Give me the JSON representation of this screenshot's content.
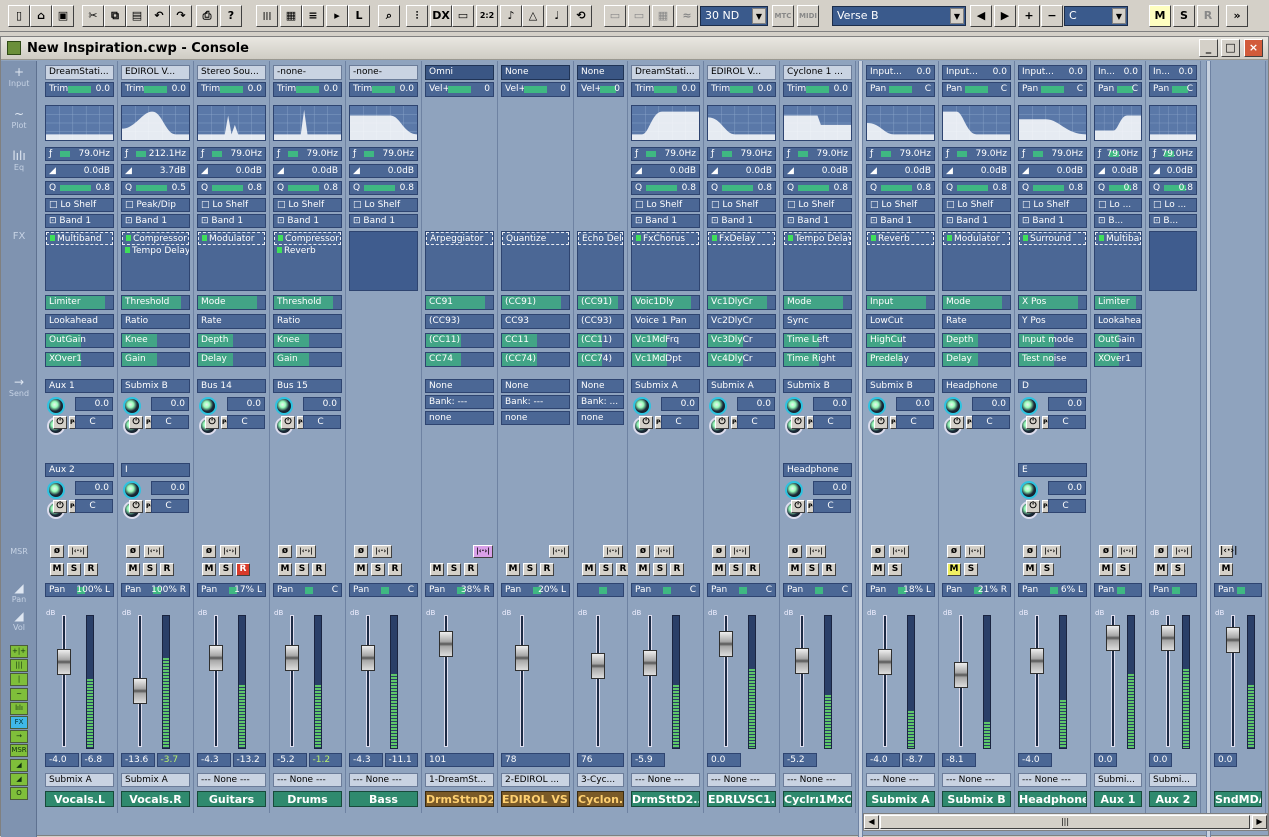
{
  "toolbar": {
    "buttons": [
      "new-icon",
      "open-icon",
      "save-icon",
      "cut-icon",
      "copy-icon",
      "paste-icon",
      "undo-icon",
      "redo-icon",
      "print-icon",
      "help-icon",
      "piano-icon",
      "grid-icon",
      "list-icon",
      "play-list-icon",
      "L",
      "zoom-icon",
      "console-icon",
      "dx-icon",
      "window-icon",
      "2:2",
      "staff-icon",
      "pattern-icon",
      "tempo-icon",
      "loop-icon",
      "monitor-icon",
      "midi-in-icon",
      "midi-out-icon",
      "wave-icon"
    ],
    "fx_preset": "30 ND",
    "mtc_label": "MTC",
    "midi_label": "MIDI",
    "section": "Verse B",
    "key": "C",
    "m_label": "M",
    "s_label": "S",
    "r_label": "R",
    "more_label": "»"
  },
  "window": {
    "title": "New Inspiration.cwp - Console",
    "min": "_",
    "max": "□",
    "close": "×"
  },
  "sidebar": {
    "labels": [
      "Input",
      "Plot",
      "Eq",
      "FX",
      "Send",
      "MSR",
      "Pan",
      "Vol"
    ],
    "buttons": [
      "+|+",
      "|||",
      "|",
      "~",
      "lılı",
      "FX",
      "→",
      "MSR",
      "◢",
      "◢",
      "O"
    ]
  },
  "strips": [
    {
      "input": "DreamStati...",
      "trim_label": "Trim",
      "trim": "0.0",
      "freq": "79.0Hz",
      "gain": "0.0dB",
      "q": "0.8",
      "shelf": "Lo Shelf",
      "band": "Band 1",
      "fx": [
        "Multiband"
      ],
      "fx_sel": 0,
      "params": [
        "Limiter",
        "Lookahead",
        "OutGain",
        "XOver1"
      ],
      "send1": "Aux 1",
      "send1_val": "0.0",
      "send1_pan": "C",
      "send2": "Aux 2",
      "send2_val": "0.0",
      "send2_pan": "C",
      "pan": "100% L",
      "left_ro": "-4.0",
      "right_ro": "-6.8",
      "out": "Submix A",
      "name": "Vocals.L",
      "kind": "audio"
    },
    {
      "input": "EDIROL V...",
      "trim_label": "Trim",
      "trim": "0.0",
      "freq": "212.1Hz",
      "gain": "3.7dB",
      "q": "0.5",
      "shelf": "Peak/Dip",
      "band": "Band 1",
      "fx": [
        "Compressor",
        "Tempo Delay"
      ],
      "fx_sel": 0,
      "params": [
        "Threshold",
        "Ratio",
        "Knee",
        "Gain"
      ],
      "send1": "Submix B",
      "send1_val": "0.0",
      "send1_pan": "C",
      "send2": "I",
      "send2_val": "0.0",
      "send2_pan": "C",
      "pan": "100% R",
      "left_ro": "-13.6",
      "right_ro": "-3.7",
      "out": "Submix A",
      "name": "Vocals.R",
      "kind": "audio"
    },
    {
      "input": "Stereo Sou...",
      "trim_label": "Trim",
      "trim": "0.0",
      "freq": "79.0Hz",
      "gain": "0.0dB",
      "q": "0.8",
      "shelf": "Lo Shelf",
      "band": "Band 1",
      "fx": [
        "Modulator"
      ],
      "fx_sel": 0,
      "params": [
        "Mode",
        "Rate",
        "Depth",
        "Delay"
      ],
      "send1": "Bus 14",
      "send1_val": "0.0",
      "send1_pan": "C",
      "pan": "17% L",
      "left_ro": "-4.3",
      "right_ro": "-13.2",
      "out": "--- None ---",
      "name": "Guitars",
      "kind": "audio",
      "rec": true
    },
    {
      "input": "-none-",
      "trim_label": "Trim",
      "trim": "0.0",
      "freq": "79.0Hz",
      "gain": "0.0dB",
      "q": "0.8",
      "shelf": "Lo Shelf",
      "band": "Band 1",
      "fx": [
        "Compressor",
        "Reverb"
      ],
      "fx_sel": 0,
      "params": [
        "Threshold",
        "Ratio",
        "Knee",
        "Gain"
      ],
      "send1": "Bus 15",
      "send1_val": "0.0",
      "send1_pan": "C",
      "pan": "C",
      "left_ro": "-5.2",
      "right_ro": "-1.2",
      "out": "--- None ---",
      "name": "Drums",
      "kind": "audio"
    },
    {
      "input": "-none-",
      "trim_label": "Trim",
      "trim": "0.0",
      "freq": "79.0Hz",
      "gain": "0.0dB",
      "q": "0.8",
      "shelf": "Lo Shelf",
      "band": "Band 1",
      "fx": [],
      "params": [],
      "pan": "C",
      "left_ro": "-4.3",
      "right_ro": "-11.1",
      "out": "--- None ---",
      "name": "Bass",
      "kind": "audio"
    },
    {
      "input": "Omni",
      "trim_label": "Vel+",
      "trim": "0",
      "fx": [
        "Arpeggiator"
      ],
      "fx_sel": 0,
      "params": [
        "CC91",
        "(CC93)",
        "(CC11)",
        "CC74"
      ],
      "sendsel": [
        "None",
        "Bank: ---",
        "none"
      ],
      "pan": "38% R",
      "left_ro": "101",
      "out": "1-DreamSt...",
      "name": "DrmSttnD21",
      "kind": "midi"
    },
    {
      "input": "None",
      "trim_label": "Vel+",
      "trim": "0",
      "fx": [
        "Quantize"
      ],
      "fx_sel": 0,
      "params": [
        "(CC91)",
        "CC93",
        "CC11",
        "(CC74)"
      ],
      "sendsel": [
        "None",
        "Bank: ---",
        "none"
      ],
      "pan": "20% L",
      "left_ro": "78",
      "out": "2-EDIROL ...",
      "name": "EDIROL VS...",
      "kind": "midi"
    },
    {
      "input": "None",
      "trim_label": "Vel+",
      "trim": "0",
      "fx": [
        "Echo Dela"
      ],
      "fx_sel": 0,
      "params": [
        "(CC91)",
        "(CC93)",
        "(CC11)",
        "(CC74)"
      ],
      "sendsel": [
        "None",
        "Bank: ...",
        "none"
      ],
      "pan": "",
      "left_ro": "76",
      "out": "3-Cyc...",
      "name": "Cyclon...",
      "kind": "midi"
    },
    {
      "input": "DreamStati...",
      "trim_label": "Trim",
      "trim": "0.0",
      "freq": "79.0Hz",
      "gain": "0.0dB",
      "q": "0.8",
      "shelf": "Lo Shelf",
      "band": "Band 1",
      "fx": [
        "FxChorus"
      ],
      "fx_sel": 0,
      "params": [
        "Voic1Dly",
        "Voice 1 Pan",
        "Vc1MdFrq",
        "Vc1MdDpt"
      ],
      "send1": "Submix A",
      "send1_val": "0.0",
      "send1_pan": "C",
      "pan": "C",
      "left_ro": "-5.9",
      "out": "--- None ---",
      "name": "DrmSttD2...",
      "kind": "synth"
    },
    {
      "input": "EDIROL V...",
      "trim_label": "Trim",
      "trim": "0.0",
      "freq": "79.0Hz",
      "gain": "0.0dB",
      "q": "0.8",
      "shelf": "Lo Shelf",
      "band": "Band 1",
      "fx": [
        "FxDelay"
      ],
      "fx_sel": 0,
      "params": [
        "Vc1DlyCr",
        "Vc2DlyCr",
        "Vc3DlyCr",
        "Vc4DlyCr"
      ],
      "send1": "Submix A",
      "send1_val": "0.0",
      "send1_pan": "C",
      "pan": "C",
      "left_ro": "0.0",
      "out": "--- None ---",
      "name": "EDRLVSC1...",
      "kind": "synth"
    },
    {
      "input": "Cyclone 1 ...",
      "trim_label": "Trim",
      "trim": "0.0",
      "freq": "79.0Hz",
      "gain": "0.0dB",
      "q": "0.8",
      "shelf": "Lo Shelf",
      "band": "Band 1",
      "fx": [
        "Tempo Delay"
      ],
      "fx_sel": 0,
      "params": [
        "Mode",
        "Sync",
        "Time Left",
        "Time Right"
      ],
      "send1": "Submix B",
      "send1_val": "0.0",
      "send1_pan": "C",
      "send2": "Headphone",
      "send2_val": "0.0",
      "send2_pan": "C",
      "pan": "C",
      "left_ro": "-5.2",
      "out": "--- None ---",
      "name": "Cyclrı1MxOt",
      "kind": "synth"
    },
    {
      "input": "Input...",
      "trim_label": "Pan",
      "trim": "C",
      "input_val": "0.0",
      "freq": "79.0Hz",
      "gain": "0.0dB",
      "q": "0.8",
      "shelf": "Lo Shelf",
      "band": "Band 1",
      "fx": [
        "Reverb"
      ],
      "fx_sel": 0,
      "params": [
        "Input",
        "LowCut",
        "HighCut",
        "Predelay"
      ],
      "send1": "Submix B",
      "send1_val": "0.0",
      "send1_pan": "C",
      "pan": "18% L",
      "left_ro": "-4.0",
      "right_ro": "-8.7",
      "out": "--- None ---",
      "name": "Submix A",
      "kind": "bus"
    },
    {
      "input": "Input...",
      "trim_label": "Pan",
      "trim": "C",
      "input_val": "0.0",
      "freq": "79.0Hz",
      "gain": "0.0dB",
      "q": "0.8",
      "shelf": "Lo Shelf",
      "band": "Band 1",
      "fx": [
        "Modulator"
      ],
      "fx_sel": 0,
      "params": [
        "Mode",
        "Rate",
        "Depth",
        "Delay"
      ],
      "send1": "Headphone",
      "send1_val": "0.0",
      "send1_pan": "C",
      "pan": "21% R",
      "left_ro": "-8.1",
      "out": "--- None ---",
      "name": "Submix B",
      "kind": "bus",
      "mute_on": true
    },
    {
      "input": "Input...",
      "trim_label": "Pan",
      "trim": "C",
      "input_val": "0.0",
      "freq": "79.0Hz",
      "gain": "0.0dB",
      "q": "0.8",
      "shelf": "Lo Shelf",
      "band": "Band 1",
      "fx": [
        "Surround"
      ],
      "fx_sel": 0,
      "params": [
        "X Pos",
        "Y Pos",
        "Input mode",
        "Test noise"
      ],
      "send1": "D",
      "send1_val": "0.0",
      "send1_pan": "C",
      "send2": "E",
      "send2_val": "0.0",
      "send2_pan": "C",
      "pan": "6% L",
      "left_ro": "-4.0",
      "out": "--- None ---",
      "name": "Headphone",
      "kind": "bus"
    },
    {
      "input": "In...",
      "trim_label": "Pan",
      "trim": "C",
      "input_val": "0.0",
      "freq": "79.0Hz",
      "gain": "0.0dB",
      "q": "0.8",
      "shelf": "Lo ...",
      "band": "B...",
      "fx": [
        "Multiba"
      ],
      "fx_sel": 0,
      "params": [
        "Limiter",
        "Lookahea",
        "OutGain",
        "XOver1"
      ],
      "pan": "",
      "left_ro": "0.0",
      "out": "Submi...",
      "name": "Aux 1",
      "kind": "bus"
    },
    {
      "input": "In...",
      "trim_label": "Pan",
      "trim": "C",
      "input_val": "0.0",
      "freq": "79.0Hz",
      "gain": "0.0dB",
      "q": "0.8",
      "shelf": "Lo ...",
      "band": "B...",
      "fx": [],
      "params": [],
      "pan": "",
      "left_ro": "0.0",
      "out": "Submi...",
      "name": "Aux 2",
      "kind": "bus"
    },
    {
      "pan": "",
      "left_ro": "0.0",
      "name": "SndMDA",
      "kind": "main"
    }
  ],
  "labels": {
    "f": "ƒ",
    "q": "Q",
    "post": "POST",
    "m": "M",
    "s": "S",
    "r": "R",
    "phase": "ø",
    "pan_label": "Pan",
    "db": "dB",
    "inf": "∞"
  },
  "scale": [
    "6",
    "",
    "",
    "0",
    "",
    "",
    "6",
    "12",
    "18",
    "24",
    "36",
    "∞"
  ],
  "meter_scale": [
    "-3",
    "-6",
    "-9",
    "-12",
    "-15",
    "-18",
    "-21",
    "-24",
    "-27",
    "-30",
    "-33",
    "-36",
    "-39"
  ]
}
